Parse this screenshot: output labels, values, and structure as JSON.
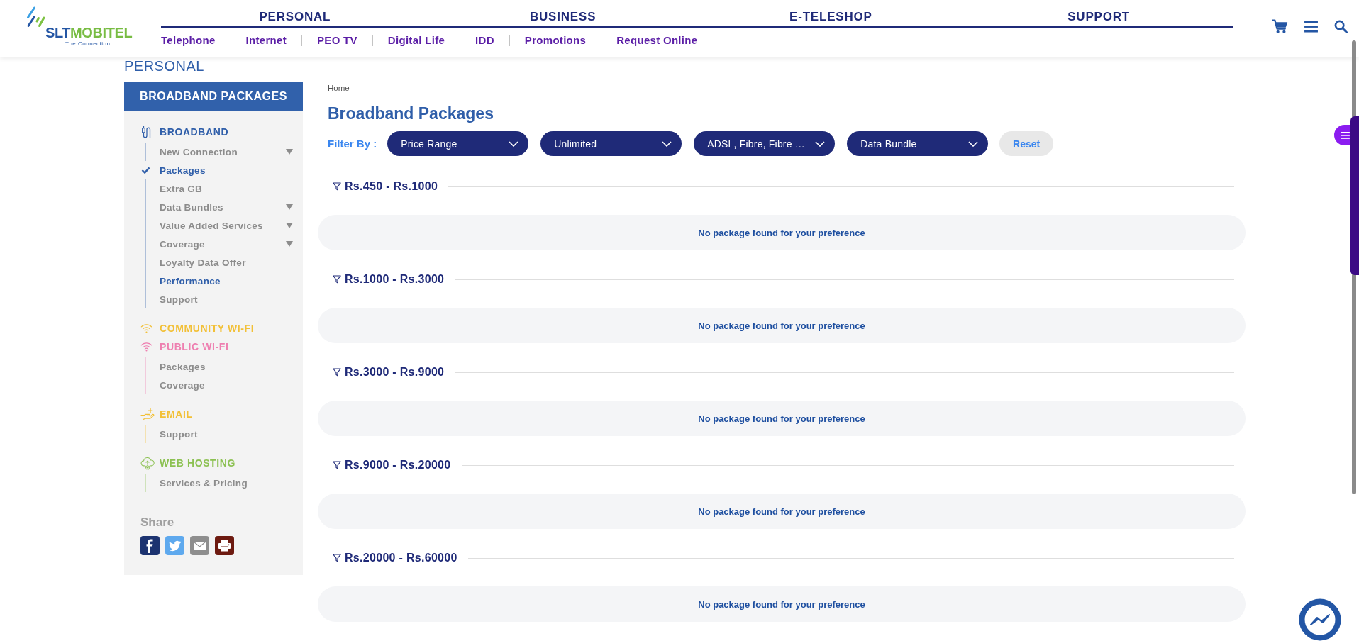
{
  "header": {
    "logo": {
      "wordmark": [
        {
          "text": "SLT",
          "color": "#2456a4"
        },
        {
          "text": "MOBITEL",
          "color": "#78bc43"
        }
      ],
      "tagline": "The Connection"
    },
    "main_nav": [
      "PERSONAL",
      "BUSINESS",
      "E-TELESHOP",
      "SUPPORT"
    ],
    "sub_nav": [
      "Telephone",
      "Internet",
      "PEO TV",
      "Digital Life",
      "IDD",
      "Promotions",
      "Request Online"
    ]
  },
  "section_label": "PERSONAL",
  "sidebar": {
    "title": "BROADBAND PACKAGES",
    "sections": [
      {
        "label": "BROADBAND",
        "kind": "cable",
        "color": "#2f5ea9",
        "children": [
          {
            "label": "New Connection",
            "expandable": true,
            "selected": false,
            "highlighted": false
          },
          {
            "label": "Packages",
            "expandable": false,
            "selected": true,
            "highlighted": true
          },
          {
            "label": "Extra GB",
            "expandable": false,
            "selected": false,
            "highlighted": false
          },
          {
            "label": "Data Bundles",
            "expandable": true,
            "selected": false,
            "highlighted": false
          },
          {
            "label": "Value Added Services",
            "expandable": true,
            "selected": false,
            "highlighted": false
          },
          {
            "label": "Coverage",
            "expandable": true,
            "selected": false,
            "highlighted": false
          },
          {
            "label": "Loyalty Data Offer",
            "expandable": false,
            "selected": false,
            "highlighted": false
          },
          {
            "label": "Performance",
            "expandable": false,
            "selected": false,
            "highlighted": true
          },
          {
            "label": "Support",
            "expandable": false,
            "selected": false,
            "highlighted": false
          }
        ]
      },
      {
        "label": "COMMUNITY WI-FI",
        "kind": "wifi",
        "color": "#f2c037"
      },
      {
        "label": "PUBLIC WI-FI",
        "kind": "wifi",
        "color": "#ee7fb0",
        "children": [
          {
            "label": "Packages",
            "expandable": false,
            "selected": false,
            "highlighted": false
          },
          {
            "label": "Coverage",
            "expandable": false,
            "selected": false,
            "highlighted": false
          }
        ]
      },
      {
        "label": "EMAIL",
        "kind": "hand",
        "color": "#f2c037",
        "children": [
          {
            "label": "Support",
            "expandable": false,
            "selected": false,
            "highlighted": false
          }
        ]
      },
      {
        "label": "WEB HOSTING",
        "kind": "cloud",
        "color": "#8cc152",
        "children": [
          {
            "label": "Services & Pricing",
            "expandable": false,
            "selected": false,
            "highlighted": false
          }
        ]
      }
    ],
    "share": {
      "label": "Share"
    }
  },
  "main": {
    "breadcrumb": [
      "Home"
    ],
    "title": "Broadband Packages",
    "filter": {
      "label": "Filter By :",
      "dropdowns": [
        {
          "value": "Price Range"
        },
        {
          "value": "Unlimited"
        },
        {
          "value": "ADSL, Fibre, Fibre …"
        },
        {
          "value": "Data Bundle"
        }
      ],
      "reset": "Reset"
    },
    "groups": [
      {
        "range": "Rs.450 - Rs.1000",
        "message": "No package found for your preference"
      },
      {
        "range": "Rs.1000 - Rs.3000",
        "message": "No package found for your preference"
      },
      {
        "range": "Rs.3000 - Rs.9000",
        "message": "No package found for your preference"
      },
      {
        "range": "Rs.9000 - Rs.20000",
        "message": "No package found for your preference"
      },
      {
        "range": "Rs.20000 - Rs.60000",
        "message": "No package found for your preference"
      }
    ]
  }
}
